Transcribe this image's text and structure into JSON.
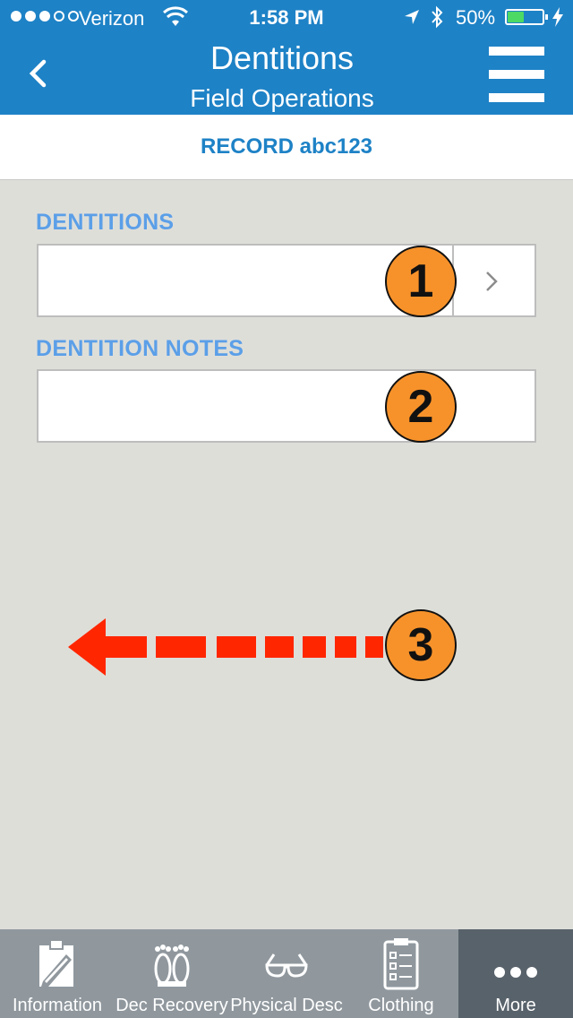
{
  "status_bar": {
    "carrier": "Verizon",
    "time": "1:58 PM",
    "battery_percent": "50%",
    "battery_level": 0.5
  },
  "header": {
    "title": "Dentitions",
    "subtitle": "Field Operations"
  },
  "record": {
    "label": "RECORD abc123"
  },
  "form": {
    "dentitions_label": "DENTITIONS",
    "dentitions_value": "",
    "notes_label": "DENTITION NOTES",
    "notes_value": ""
  },
  "annotations": {
    "badge_1": "1",
    "badge_2": "2",
    "badge_3": "3",
    "badge_color": "#f7922a",
    "arrow_color": "#ff2600"
  },
  "tabs": [
    {
      "label": "Information",
      "icon": "clipboard-pencil-icon"
    },
    {
      "label": "Dec Recovery",
      "icon": "feet-icon"
    },
    {
      "label": "Physical Desc",
      "icon": "glasses-icon"
    },
    {
      "label": "Clothing",
      "icon": "checklist-icon"
    },
    {
      "label": "More",
      "icon": "more-dots-icon"
    }
  ],
  "colors": {
    "header_blue": "#1e82c6",
    "label_blue": "#5b9fe8",
    "background": "#deded9",
    "tabbar": "#90989e",
    "tab_active": "#58626b"
  }
}
